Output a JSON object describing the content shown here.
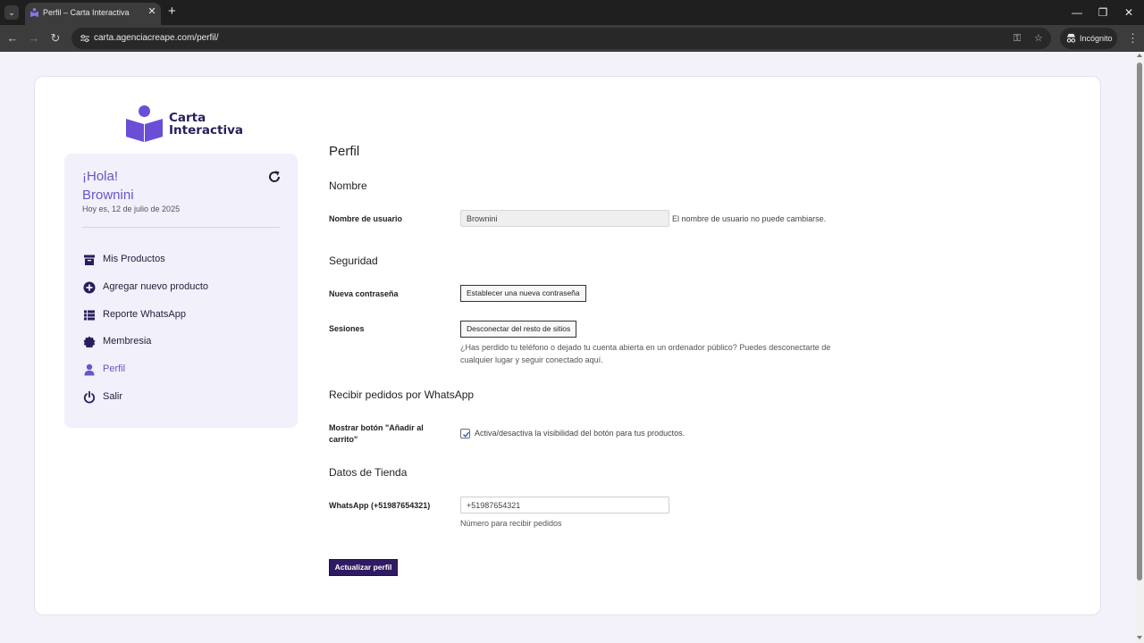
{
  "browser": {
    "tab_title": "Perfil – Carta Interactiva",
    "url": "carta.agenciacreape.com/perfil/",
    "incognito_label": "Incógnito"
  },
  "logo": {
    "line1": "Carta",
    "line2": "Interactiva",
    "color": "#2a1d5c",
    "mark_color": "#6a4fd6"
  },
  "sidebar": {
    "greeting": "¡Hola!",
    "username": "Brownini",
    "date": "Hoy es, 12 de julio de 2025",
    "items": [
      {
        "label": "Mis Productos",
        "icon": "archive-icon"
      },
      {
        "label": "Agregar nuevo producto",
        "icon": "plus-circle-icon"
      },
      {
        "label": "Reporte WhatsApp",
        "icon": "list-icon"
      },
      {
        "label": "Membresia",
        "icon": "badge-icon"
      },
      {
        "label": "Perfil",
        "icon": "user-icon",
        "active": true
      },
      {
        "label": "Salir",
        "icon": "power-icon"
      }
    ]
  },
  "form": {
    "page_title": "Perfil",
    "sections": {
      "name": "Nombre",
      "security": "Seguridad",
      "whatsapp_orders": "Recibir pedidos por WhatsApp",
      "store": "Datos de Tienda"
    },
    "username_label": "Nombre de usuario",
    "username_value": "Brownini",
    "username_hint": "El nombre de usuario no puede cambiarse.",
    "password_label": "Nueva contraseña",
    "password_button": "Establecer una nueva contraseña",
    "sessions_label": "Sesiones",
    "sessions_button": "Desconectar del resto de sitios",
    "sessions_desc": "¿Has perdido tu teléfono o dejado tu cuenta abierta en un ordenador público? Puedes desconectarte de cualquier lugar y seguir conectado aquí.",
    "cart_label": "Mostrar botón \"Añadir al carrito\"",
    "cart_checked": true,
    "cart_desc": "Activa/desactiva la visibilidad del botón para tus productos.",
    "whatsapp_label": "WhatsApp (+51987654321)",
    "whatsapp_value": "+51987654321",
    "whatsapp_hint": "Número para recibir pedidos",
    "submit": "Actualizar perfil"
  },
  "colors": {
    "accent": "#6a55c8",
    "primary_button": "#2f1b62",
    "sidebar_bg": "#f1f0fb",
    "page_bg": "#f3f2fb"
  }
}
